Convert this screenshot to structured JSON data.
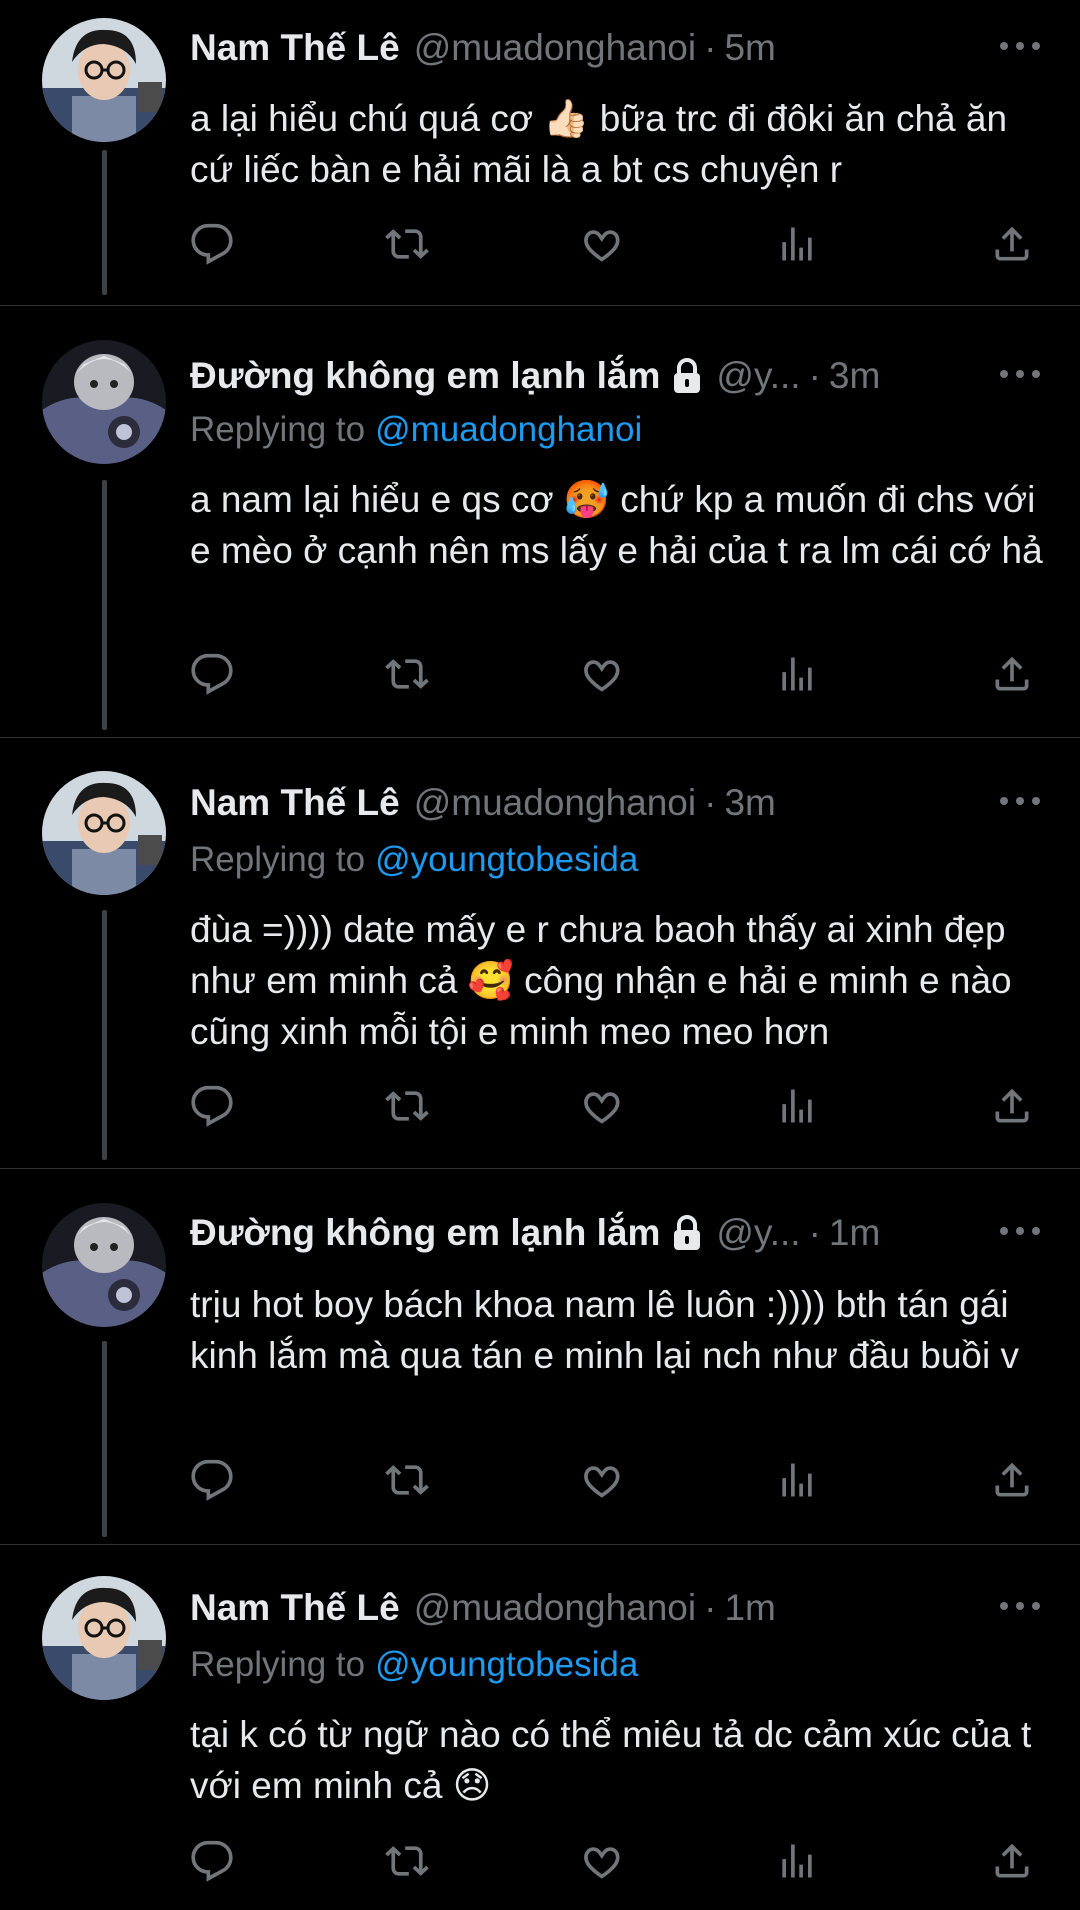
{
  "tweets": [
    {
      "name": "Nam Thế Lê",
      "handle": "@muadonghanoi",
      "time": "5m",
      "replying_prefix": "",
      "replying_to": "",
      "text": "a lại hiểu chú quá cơ 👍🏻 bữa trc đi đôki ăn chả ăn cứ liếc bàn e hải mãi là a bt cs chuyện r",
      "avatar": "man-glasses-avatar",
      "locked": false
    },
    {
      "name": "Đường không em lạnh lắm",
      "handle": "@y...",
      "time": "3m",
      "replying_prefix": "Replying to",
      "replying_to": "@muadonghanoi",
      "text": "a nam lại hiểu e qs cơ 🥵 chứ kp a muốn đi chs với e mèo ở cạnh nên ms lấy e hải của t ra lm cái cớ hả",
      "avatar": "anime-avatar",
      "locked": true
    },
    {
      "name": "Nam Thế Lê",
      "handle": "@muadonghanoi",
      "time": "3m",
      "replying_prefix": "Replying to",
      "replying_to": "@youngtobesida",
      "text": "đùa =)))) date mấy e r chưa baoh thấy ai xinh đẹp như em minh cả 🥰 công nhận e hải e minh e nào cũng xinh mỗi tội e minh meo meo hơn",
      "avatar": "man-glasses-avatar",
      "locked": false
    },
    {
      "name": "Đường không em lạnh lắm",
      "handle": "@y...",
      "time": "1m",
      "replying_prefix": "",
      "replying_to": "",
      "text": "trịu hot boy bách khoa nam lê luôn :)))) bth tán gái kinh lắm mà qua tán e minh lại nch như đầu buồi v",
      "avatar": "anime-avatar",
      "locked": true
    },
    {
      "name": "Nam Thế Lê",
      "handle": "@muadonghanoi",
      "time": "1m",
      "replying_prefix": "Replying to",
      "replying_to": "@youngtobesida",
      "text": "tại k có từ ngữ nào có thể miêu tả dc cảm xúc của t với em minh cả 😞",
      "avatar": "man-glasses-avatar",
      "locked": false
    }
  ],
  "dot": "·",
  "colors": {
    "background": "#000000",
    "text": "#e7e9ea",
    "secondary": "#71767b",
    "accent": "#1d9bf0",
    "divider": "#2f3336"
  },
  "icons": [
    "reply-icon",
    "retweet-icon",
    "like-icon",
    "views-icon",
    "share-icon",
    "more-icon",
    "lock-icon"
  ]
}
